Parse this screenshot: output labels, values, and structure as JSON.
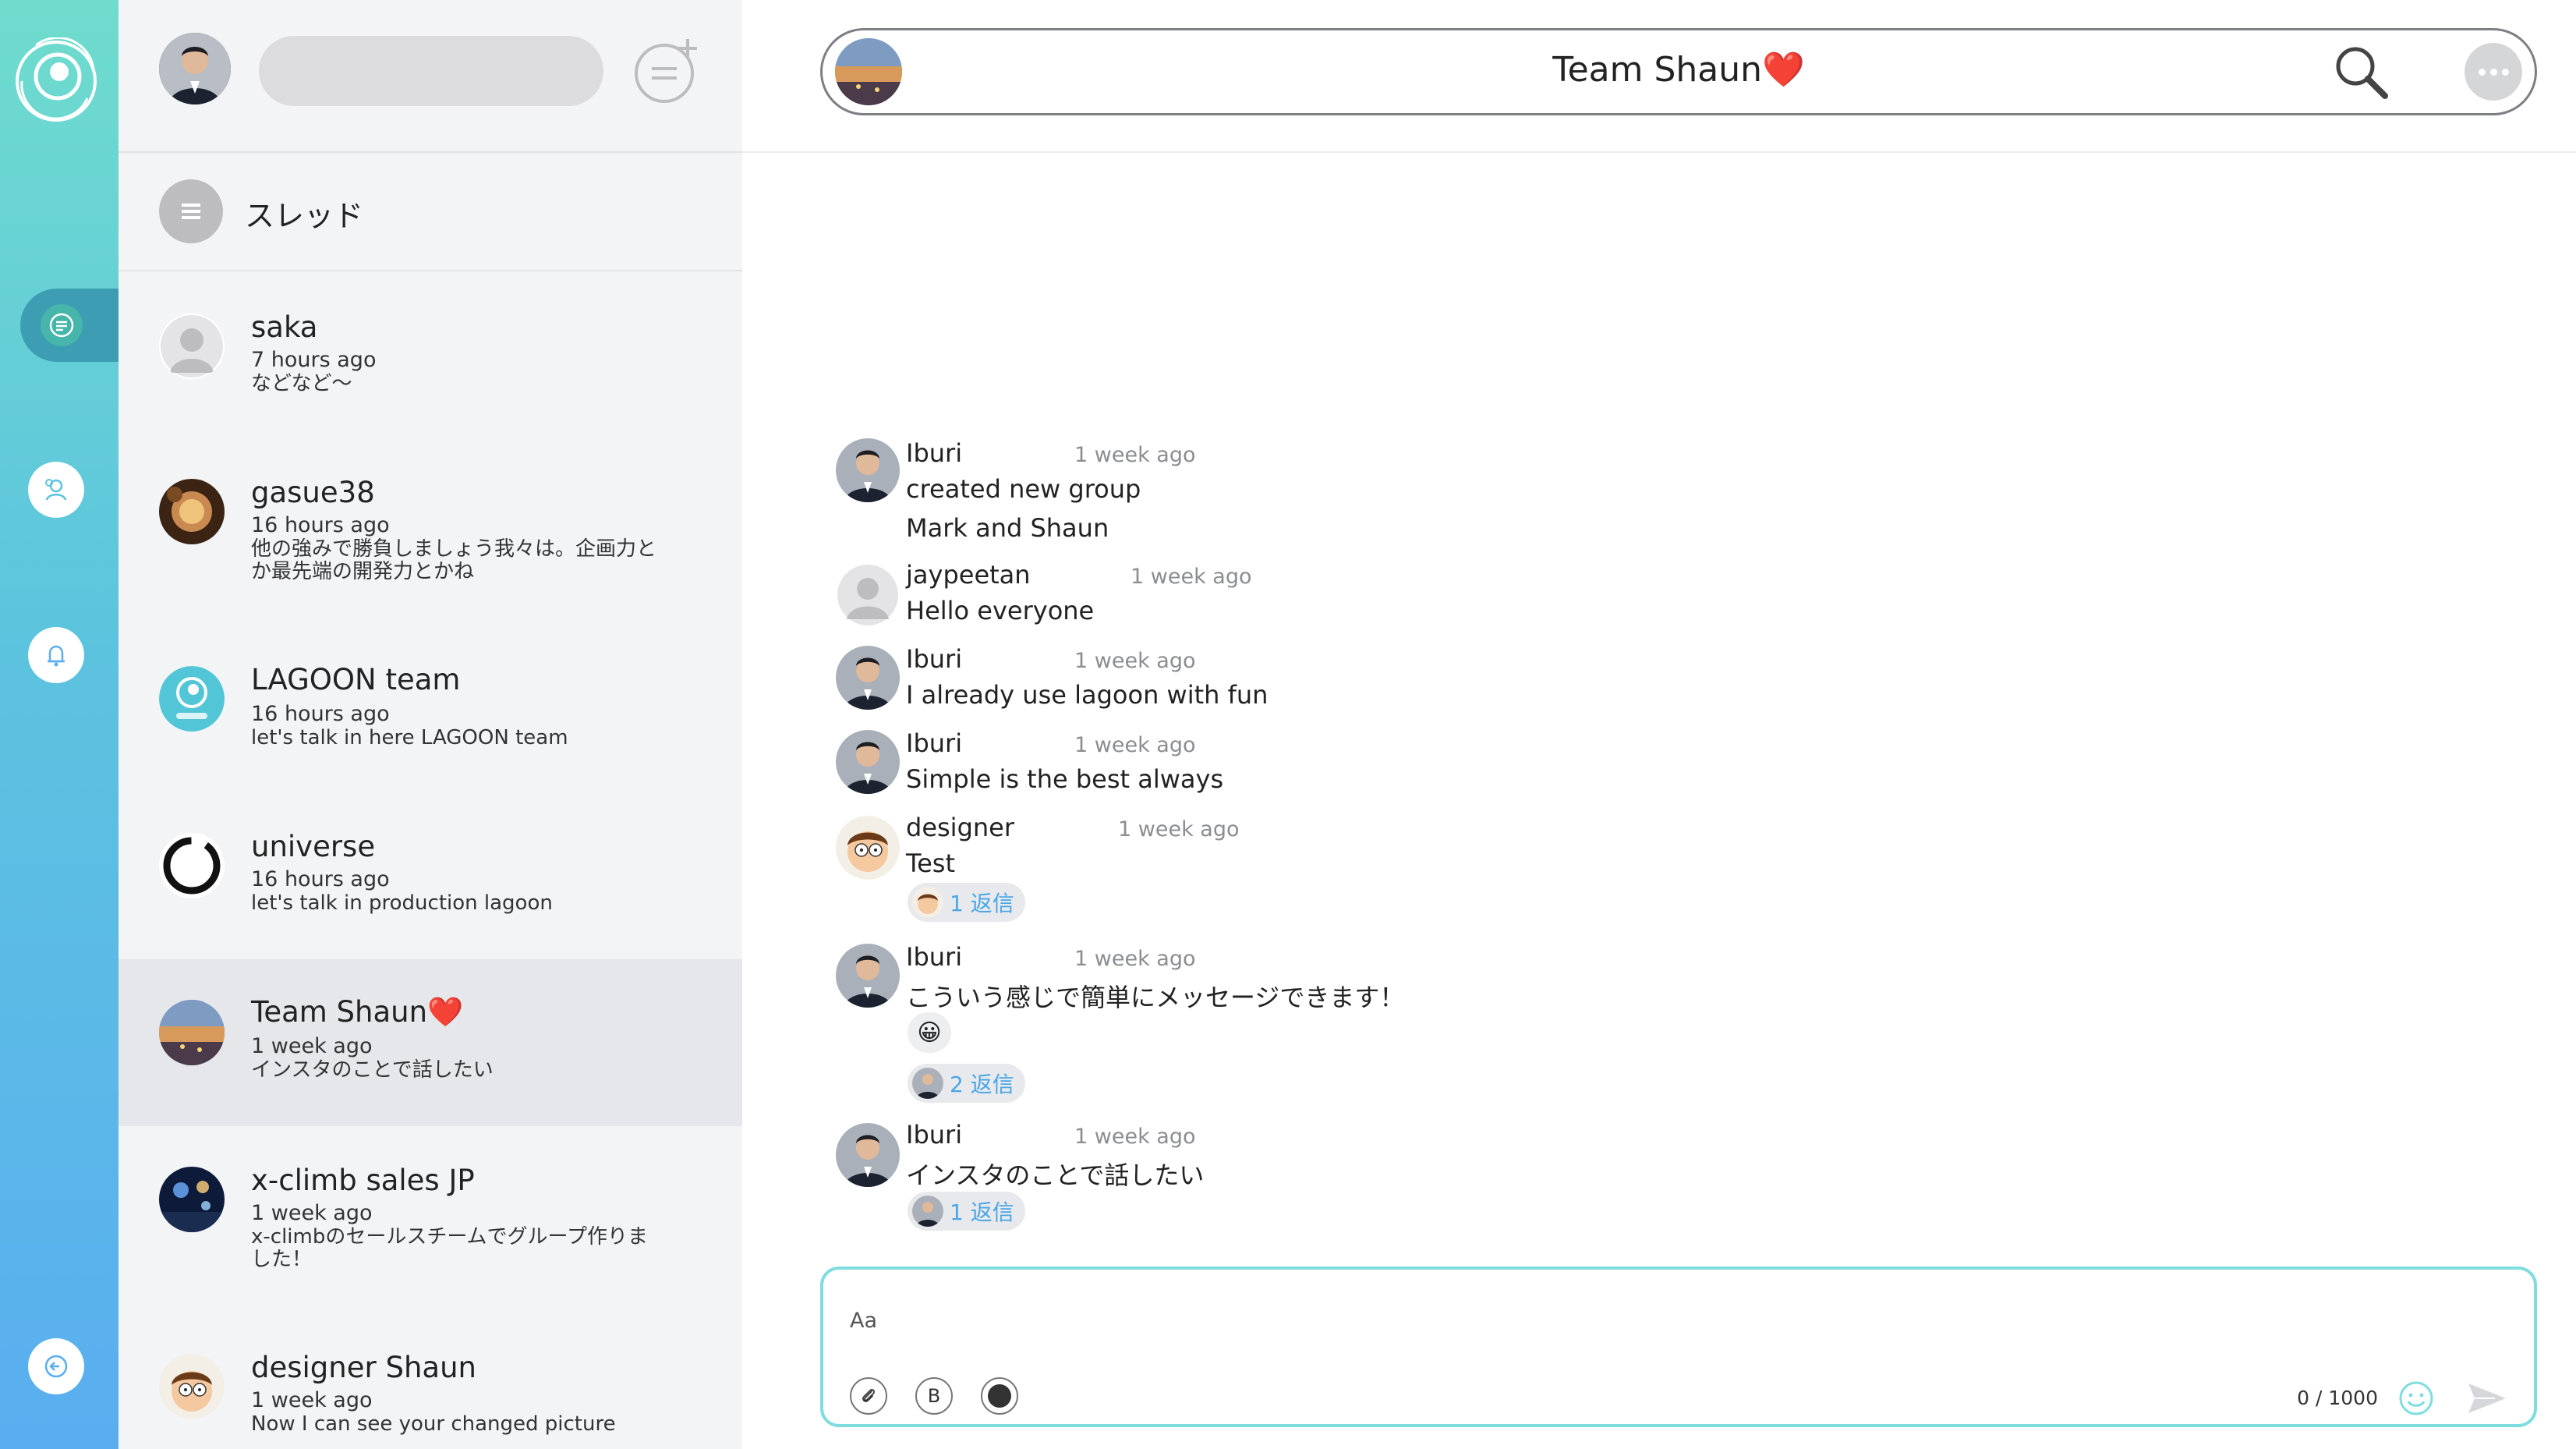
{
  "sidebar_rail": {
    "items": [
      {
        "name": "logo",
        "icon": "lagoon-logo-icon"
      },
      {
        "name": "threads",
        "icon": "chat-bubble-icon",
        "active": true
      },
      {
        "name": "contacts",
        "icon": "users-icon"
      },
      {
        "name": "notifications",
        "icon": "bell-icon"
      },
      {
        "name": "logout",
        "icon": "logout-icon"
      }
    ]
  },
  "thread_panel": {
    "header_label": "スレッド",
    "conversations": [
      {
        "name": "saka",
        "time": "7 hours ago",
        "preview": "などなど～"
      },
      {
        "name": "gasue38",
        "time": "16 hours ago",
        "preview": "他の強みで勝負しましょう我々は。企画力とか最先端の開発力とかね"
      },
      {
        "name": "LAGOON team",
        "time": "16 hours ago",
        "preview": "let's talk in here LAGOON team"
      },
      {
        "name": "universe",
        "time": "16 hours ago",
        "preview": "let's talk in production lagoon"
      },
      {
        "name": "Team Shaun❤️",
        "time": "1 week ago",
        "preview": "インスタのことで話したい",
        "active": true
      },
      {
        "name": "x-climb sales JP",
        "time": "1 week ago",
        "preview": "x-climbのセールスチームでグループ作りました！"
      },
      {
        "name": "designer Shaun",
        "time": "1 week ago",
        "preview": "Now I can see your changed picture"
      }
    ]
  },
  "chat": {
    "title": "Team Shaun❤️",
    "messages": [
      {
        "author": "Iburi",
        "time": "1 week ago",
        "lines": [
          "created new group",
          "Mark and Shaun"
        ]
      },
      {
        "author": "jaypeetan",
        "time": "1 week ago",
        "lines": [
          "Hello everyone"
        ]
      },
      {
        "author": "Iburi",
        "time": "1 week ago",
        "lines": [
          "I already use lagoon with fun"
        ]
      },
      {
        "author": "Iburi",
        "time": "1 week ago",
        "lines": [
          "Simple is the best always"
        ]
      },
      {
        "author": "designer",
        "time": "1 week ago",
        "lines": [
          "Test"
        ],
        "replies": "1 返信"
      },
      {
        "author": "Iburi",
        "time": "1 week ago",
        "lines": [
          "こういう感じで簡単にメッセージできます！"
        ],
        "reaction": "😀",
        "replies": "2 返信"
      },
      {
        "author": "Iburi",
        "time": "1 week ago",
        "lines": [
          "インスタのことで話したい"
        ],
        "replies": "1 返信"
      }
    ]
  },
  "composer": {
    "placeholder": "Aa",
    "value": "",
    "counter": "0 / 1000",
    "bold_label": "B"
  },
  "colors": {
    "accent": "#7fdde0",
    "link": "#4aa6e6",
    "rail_top": "#6fdccd",
    "rail_bottom": "#5aaef0",
    "heart": "#e0242a"
  }
}
